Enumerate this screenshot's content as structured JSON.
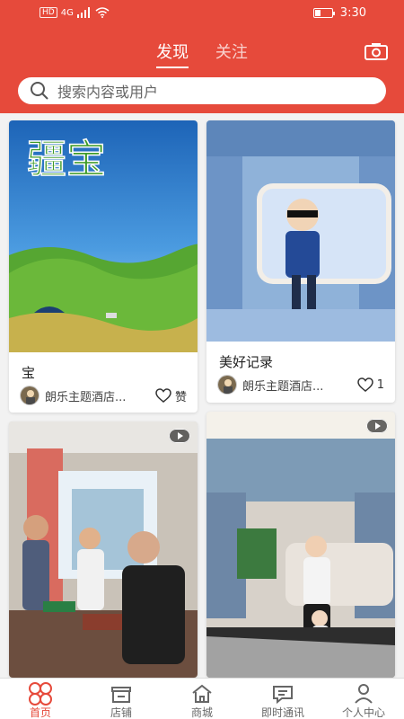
{
  "status_bar": {
    "network_badge": "HD",
    "network_type": "4G",
    "signal_icon": "signal-bars-icon",
    "wifi_icon": "wifi-icon",
    "battery_icon": "battery-icon",
    "battery_level": 0.35,
    "time": "3:30"
  },
  "header": {
    "tabs": [
      {
        "label": "发现",
        "active": true
      },
      {
        "label": "关注",
        "active": false
      }
    ],
    "camera_icon": "camera-icon",
    "search": {
      "icon": "search-icon",
      "placeholder": "搜索内容或用户"
    }
  },
  "cards": [
    {
      "image_text": "疆宝",
      "title": "宝",
      "author": "朗乐主题酒店...",
      "like_icon": "heart-outline-icon",
      "like_label": "赞",
      "has_video_badge": false
    },
    {
      "title": "美好记录",
      "author": "朗乐主题酒店...",
      "like_icon": "heart-outline-icon",
      "like_label": "1",
      "has_video_badge": false
    },
    {
      "title": "",
      "author": "",
      "like_icon": "",
      "like_label": "",
      "has_video_badge": true
    },
    {
      "title": "",
      "author": "",
      "like_icon": "",
      "like_label": "",
      "has_video_badge": true
    }
  ],
  "tabbar": {
    "items": [
      {
        "label": "首页",
        "icon": "home-dots-icon",
        "active": true
      },
      {
        "label": "店铺",
        "icon": "storefront-icon",
        "active": false
      },
      {
        "label": "商城",
        "icon": "house-icon",
        "active": false
      },
      {
        "label": "即时通讯",
        "icon": "message-icon",
        "active": false
      },
      {
        "label": "个人中心",
        "icon": "person-icon",
        "active": false
      }
    ]
  },
  "colors": {
    "accent": "#e64a3b",
    "text_dark": "#222222",
    "text_gray": "#666666",
    "background": "#f2f2f2"
  }
}
